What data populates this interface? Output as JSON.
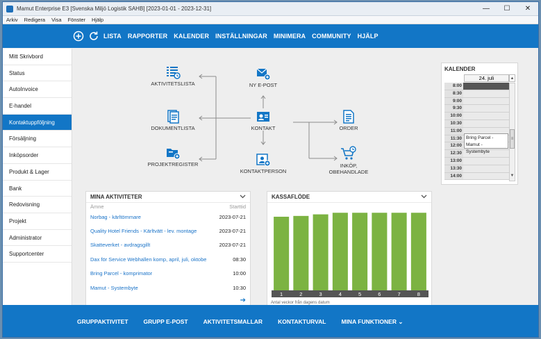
{
  "window": {
    "title": "Mamut Enterprise E3  [Svenska Miljö Logistik SAHB]  [2023-01-01 - 2023-12-31]",
    "minimize": "—",
    "maximize": "☐",
    "close": "✕"
  },
  "menubar": [
    "Arkiv",
    "Redigera",
    "Visa",
    "Fönster",
    "Hjälp"
  ],
  "topnav": {
    "icons": [
      "plus-circle-icon",
      "refresh-icon"
    ],
    "items": [
      "LISTA",
      "RAPPORTER",
      "KALENDER",
      "INSTÄLLNINGAR",
      "MINIMERA",
      "COMMUNITY",
      "HJÄLP"
    ]
  },
  "sidebar": {
    "items": [
      "Mitt Skrivbord",
      "Status",
      "AutoInvoice",
      "E-handel",
      "Kontaktuppföljning",
      "Försäljning",
      "Inköpsorder",
      "Produkt & Lager",
      "Bank",
      "Redovisning",
      "Projekt",
      "Administrator",
      "Supportcenter"
    ],
    "active": "Kontaktuppföljning"
  },
  "flow": {
    "activity_list": "AKTIVITETSLISTA",
    "document_list": "DOKUMENTLISTA",
    "project_register": "PROJEKTREGISTER",
    "new_email": "NY E-POST",
    "contact": "KONTAKT",
    "contact_person": "KONTAKTPERSON",
    "order": "ORDER",
    "purchase_line1": "INKÖP,",
    "purchase_line2": "OBEHANDLADE",
    "accent": "#1276c6"
  },
  "calendar": {
    "title": "KALENDER",
    "date": "24. juli",
    "times": [
      "8:00",
      "8:30",
      "9:00",
      "9:30",
      "10:00",
      "10:30",
      "11:00",
      "11:30",
      "12:00",
      "12:30",
      "13:00",
      "13:30",
      "14:00"
    ],
    "event_line1": "Bring Parcel -",
    "event_line2": "Mamut - Systembyte"
  },
  "activities": {
    "title": "MINA AKTIVITETER",
    "col_subject": "Ämne",
    "col_start": "Starttid",
    "rows": [
      {
        "subject": "Norbag - kärltömmare",
        "start": "2023-07-21"
      },
      {
        "subject": "Quality Hotel Friends    - Kärltvätt - lev. montage",
        "start": "2023-07-21"
      },
      {
        "subject": "Skatteverket - avdragsgillt",
        "start": "2023-07-21"
      },
      {
        "subject": "Dax för Service Webhallen komp, april, juli, oktobe",
        "start": "08:30"
      },
      {
        "subject": "Bring Parcel - komprimator",
        "start": "10:00"
      },
      {
        "subject": "Mamut - Systembyte",
        "start": "10:30"
      }
    ]
  },
  "cashflow": {
    "title": "KASSAFLÖDE",
    "footnote": "Antal veckor från dagens datum"
  },
  "chart_data": {
    "type": "bar",
    "title": "KASSAFLÖDE",
    "categories": [
      "1",
      "2",
      "3",
      "4",
      "5",
      "6",
      "7",
      "8"
    ],
    "values": [
      93,
      94,
      96,
      98,
      98,
      98,
      98,
      98
    ],
    "xlabel": "Antal veckor från dagens datum",
    "ylabel": "",
    "ylim": [
      0,
      100
    ],
    "grid": false,
    "bar_color": "#7cb342",
    "axis_color": "#555555"
  },
  "bottombar": {
    "items": [
      "GRUPPAKTIVITET",
      "GRUPP E-POST",
      "AKTIVITETSMALLAR",
      "KONTAKTURVAL",
      "MINA FUNKTIONER ⌄"
    ]
  }
}
